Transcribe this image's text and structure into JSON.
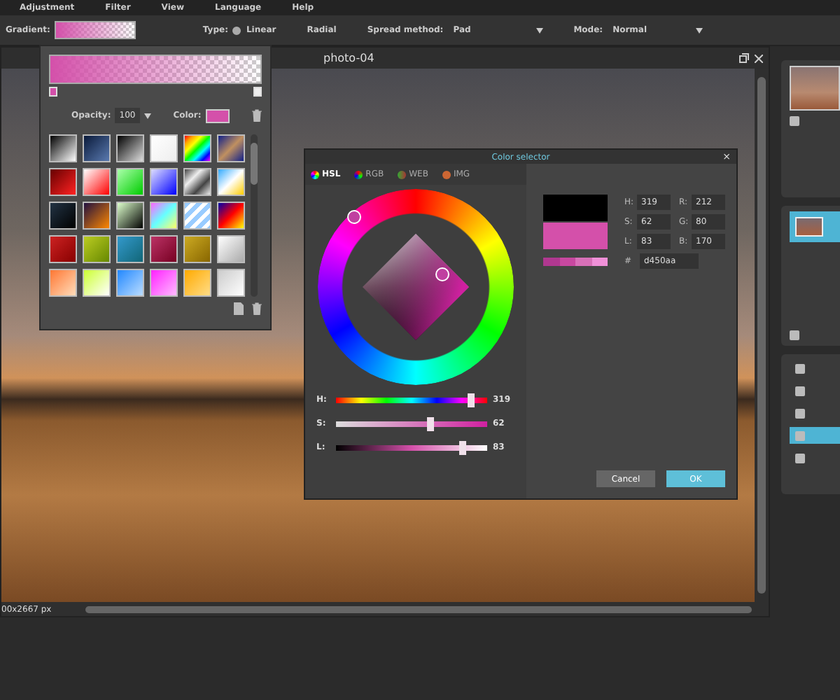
{
  "menu": {
    "items": [
      "Adjustment",
      "Filter",
      "View",
      "Language",
      "Help"
    ]
  },
  "toolbar": {
    "gradient_label": "Gradient:",
    "type_label": "Type:",
    "types": [
      {
        "label": "Linear",
        "selected": true
      },
      {
        "label": "Radial",
        "selected": false
      }
    ],
    "spread_label": "Spread method:",
    "spread_value": "Pad",
    "mode_label": "Mode:",
    "mode_value": "Normal"
  },
  "document": {
    "title": "photo-04",
    "status": "00x2667 px"
  },
  "gradient_popup": {
    "opacity_label": "Opacity:",
    "opacity_value": "100",
    "color_label": "Color:",
    "color": "#d450aa"
  },
  "color_selector": {
    "title": "Color selector",
    "close": "×",
    "tabs": [
      {
        "label": "HSL",
        "selected": true
      },
      {
        "label": "RGB",
        "selected": false
      },
      {
        "label": "WEB",
        "selected": false
      },
      {
        "label": "IMG",
        "selected": false
      }
    ],
    "sliders": [
      {
        "label": "H:",
        "level": 0.886,
        "value": "319"
      },
      {
        "label": "S:",
        "level": 0.62,
        "value": "62"
      },
      {
        "label": "L:",
        "level": 0.83,
        "value": "83"
      }
    ],
    "fields": [
      {
        "label": "H:",
        "value": "319"
      },
      {
        "label": "R:",
        "value": "212"
      },
      {
        "label": "S:",
        "value": "62"
      },
      {
        "label": "G:",
        "value": "80"
      },
      {
        "label": "L:",
        "value": "83"
      },
      {
        "label": "B:",
        "value": "170"
      }
    ],
    "hex_label": "#",
    "hex_value": "d450aa",
    "buttons": [
      {
        "label": "Cancel",
        "kind": "secondary"
      },
      {
        "label": "OK",
        "kind": "primary"
      }
    ]
  }
}
